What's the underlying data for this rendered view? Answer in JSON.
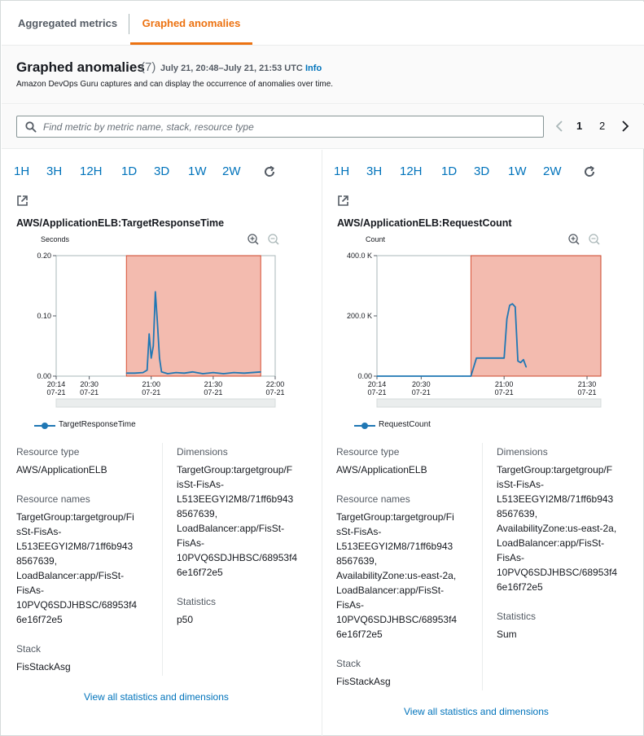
{
  "tabs": [
    {
      "label": "Aggregated metrics",
      "active": false
    },
    {
      "label": "Graphed anomalies",
      "active": true
    }
  ],
  "header": {
    "title": "Graphed anomalies",
    "count": "(7)",
    "time_range": "July 21, 20:48–July 21, 21:53 UTC",
    "info_link": "Info",
    "description": "Amazon DevOps Guru captures and can display the occurrence of anomalies over time."
  },
  "search": {
    "placeholder": "Find metric by metric name, stack, resource type",
    "value": ""
  },
  "pagination": {
    "pages": [
      "1",
      "2"
    ],
    "current": "1"
  },
  "time_ranges": [
    "1H",
    "3H",
    "12H",
    "1D",
    "3D",
    "1W",
    "2W"
  ],
  "colors": {
    "accent": "#ec7211",
    "link": "#0073bb",
    "anomaly": "#f2b0a2",
    "anomaly_border": "#d13212",
    "series": "#1f77b4"
  },
  "panels": [
    {
      "metric_title": "AWS/ApplicationELB:TargetResponseTime",
      "legend": "TargetResponseTime",
      "resource_type_label": "Resource type",
      "resource_type": "AWS/ApplicationELB",
      "resource_names_label": "Resource names",
      "resource_names": "TargetGroup:targetgroup/Fi\nsSt-FisAs-\nL513EEGYI2M8/71ff6b943\n8567639,\nLoadBalancer:app/FisSt-\nFisAs-\n10PVQ6SDJHBSC/68953f4\n6e16f72e5",
      "stack_label": "Stack",
      "stack": "FisStackAsg",
      "dimensions_label": "Dimensions",
      "dimensions": "TargetGroup:targetgroup/F\nisSt-FisAs-\nL513EEGYI2M8/71ff6b943\n8567639,\nLoadBalancer:app/FisSt-\nFisAs-\n10PVQ6SDJHBSC/68953f4\n6e16f72e5",
      "statistics_label": "Statistics",
      "statistics": "p50",
      "view_all": "View all statistics and dimensions"
    },
    {
      "metric_title": "AWS/ApplicationELB:RequestCount",
      "legend": "RequestCount",
      "resource_type_label": "Resource type",
      "resource_type": "AWS/ApplicationELB",
      "resource_names_label": "Resource names",
      "resource_names": "TargetGroup:targetgroup/Fi\nsSt-FisAs-\nL513EEGYI2M8/71ff6b943\n8567639,\nAvailabilityZone:us-east-2a,\nLoadBalancer:app/FisSt-\nFisAs-\n10PVQ6SDJHBSC/68953f4\n6e16f72e5",
      "stack_label": "Stack",
      "stack": "FisStackAsg",
      "dimensions_label": "Dimensions",
      "dimensions": "TargetGroup:targetgroup/F\nisSt-FisAs-\nL513EEGYI2M8/71ff6b943\n8567639,\nAvailabilityZone:us-east-2a,\nLoadBalancer:app/FisSt-\nFisAs-\n10PVQ6SDJHBSC/68953f4\n6e16f72e5",
      "statistics_label": "Statistics",
      "statistics": "Sum",
      "view_all": "View all statistics and dimensions"
    }
  ],
  "chart_data": [
    {
      "type": "line",
      "title": "AWS/ApplicationELB:TargetResponseTime",
      "ylabel": "Seconds",
      "yticks": [
        "0.00",
        "0.10",
        "0.20"
      ],
      "ylim": [
        0,
        0.2
      ],
      "xticks": [
        [
          "20:14",
          "07-21"
        ],
        [
          "20:30",
          "07-21"
        ],
        [
          "21:00",
          "07-21"
        ],
        [
          "21:30",
          "07-21"
        ],
        [
          "22:00",
          "07-21"
        ]
      ],
      "xlim": [
        "20:14",
        "22:00"
      ],
      "anomaly_range": [
        "20:48",
        "21:53"
      ],
      "series": [
        {
          "name": "TargetResponseTime",
          "points": [
            [
              "20:48",
              0.005
            ],
            [
              "20:52",
              0.005
            ],
            [
              "20:56",
              0.006
            ],
            [
              "20:58",
              0.01
            ],
            [
              "20:59",
              0.07
            ],
            [
              "21:00",
              0.03
            ],
            [
              "21:01",
              0.05
            ],
            [
              "21:02",
              0.14
            ],
            [
              "21:03",
              0.09
            ],
            [
              "21:04",
              0.03
            ],
            [
              "21:05",
              0.007
            ],
            [
              "21:08",
              0.004
            ],
            [
              "21:12",
              0.006
            ],
            [
              "21:16",
              0.005
            ],
            [
              "21:20",
              0.007
            ],
            [
              "21:25",
              0.004
            ],
            [
              "21:30",
              0.006
            ],
            [
              "21:35",
              0.004
            ],
            [
              "21:40",
              0.006
            ],
            [
              "21:45",
              0.005
            ],
            [
              "21:53",
              0.007
            ]
          ]
        }
      ]
    },
    {
      "type": "line",
      "title": "AWS/ApplicationELB:RequestCount",
      "ylabel": "Count",
      "yticks": [
        "0.00",
        "200.0 K",
        "400.0 K"
      ],
      "ylim": [
        0,
        400000
      ],
      "xticks": [
        [
          "20:14",
          "07-21"
        ],
        [
          "20:30",
          "07-21"
        ],
        [
          "21:00",
          "07-21"
        ],
        [
          "21:30",
          "07-21"
        ]
      ],
      "xlim": [
        "20:14",
        "21:35"
      ],
      "anomaly_range": [
        "20:48",
        "21:53"
      ],
      "series": [
        {
          "name": "RequestCount",
          "points": [
            [
              "20:14",
              0
            ],
            [
              "20:45",
              0
            ],
            [
              "20:48",
              0
            ],
            [
              "20:50",
              60000
            ],
            [
              "20:58",
              60000
            ],
            [
              "21:00",
              60000
            ],
            [
              "21:01",
              190000
            ],
            [
              "21:02",
              235000
            ],
            [
              "21:03",
              240000
            ],
            [
              "21:04",
              230000
            ],
            [
              "21:05",
              50000
            ],
            [
              "21:06",
              45000
            ],
            [
              "21:07",
              55000
            ],
            [
              "21:08",
              30000
            ]
          ]
        }
      ]
    }
  ]
}
